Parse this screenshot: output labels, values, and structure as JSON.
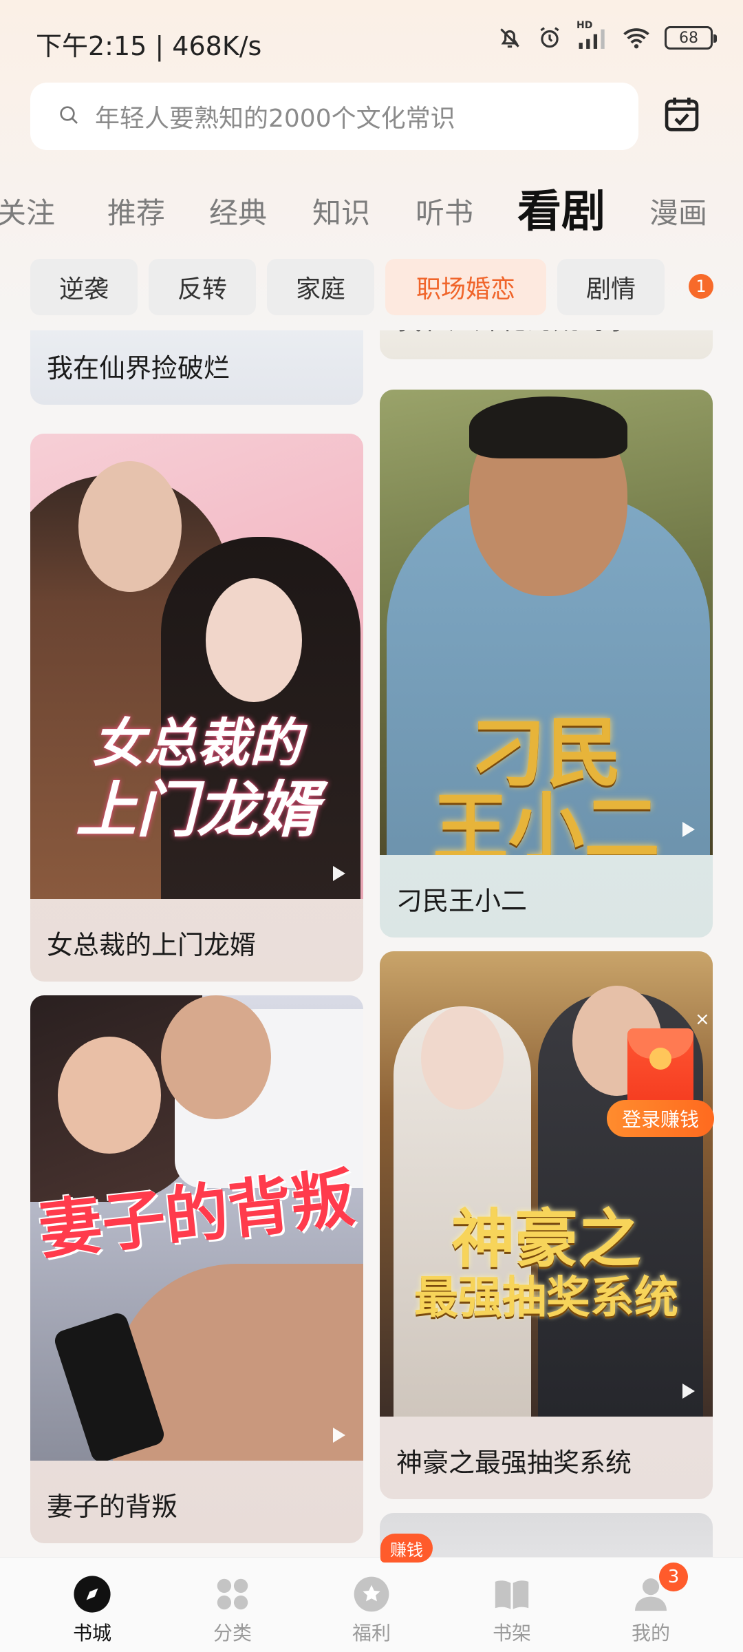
{
  "status_bar": {
    "time": "下午2:15 | 468K/s",
    "battery": "68",
    "network_tag": "HD"
  },
  "search": {
    "placeholder": "年轻人要熟知的2000个文化常识"
  },
  "tabs": [
    {
      "label": "关注"
    },
    {
      "label": "推荐"
    },
    {
      "label": "经典"
    },
    {
      "label": "知识"
    },
    {
      "label": "听书"
    },
    {
      "label": "看剧"
    },
    {
      "label": "漫画"
    }
  ],
  "active_tab": "看剧",
  "chips": [
    {
      "label": "逆袭"
    },
    {
      "label": "反转"
    },
    {
      "label": "家庭"
    },
    {
      "label": "职场婚恋"
    },
    {
      "label": "剧情"
    }
  ],
  "active_chip": "职场婚恋",
  "chip_badge": "1",
  "feed": {
    "left": [
      {
        "title": "我在仙界捡破烂"
      },
      {
        "title": "女总裁的上门龙婿",
        "cover_text_1": "女总裁的",
        "cover_text_2": "上门龙婿"
      },
      {
        "title": "妻子的背叛",
        "cover_text": "妻子的背叛"
      }
    ],
    "right": [
      {
        "title": "我和姐妹花的荒岛求生"
      },
      {
        "title": "刁民王小二",
        "cover_text_1": "刁民",
        "cover_text_2": "王小二"
      },
      {
        "title": "神豪之最强抽奖系统",
        "cover_text_1": "神豪之",
        "cover_text_2": "最强抽奖系统"
      }
    ]
  },
  "promo": {
    "label": "登录赚钱",
    "close": "×"
  },
  "bottom_nav": [
    {
      "label": "书城",
      "icon": "compass-icon"
    },
    {
      "label": "分类",
      "icon": "grid-icon"
    },
    {
      "label": "福利",
      "icon": "gift-icon"
    },
    {
      "label": "书架",
      "icon": "book-icon"
    },
    {
      "label": "我的",
      "icon": "person-icon"
    }
  ],
  "earn_badge": "赚钱",
  "me_badge": "3",
  "colors": {
    "accent": "#f0652b",
    "badge": "#ff5b2b"
  }
}
